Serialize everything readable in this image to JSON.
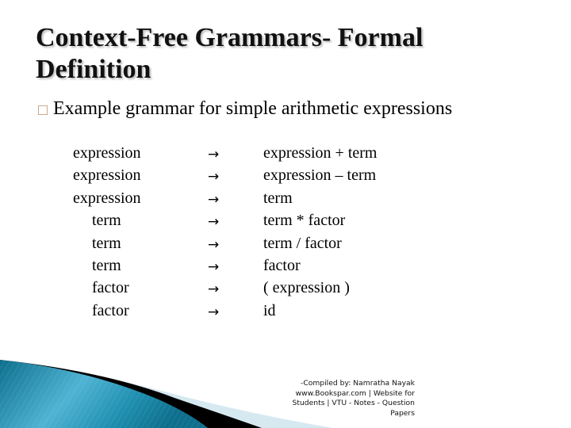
{
  "slide": {
    "title": "Context-Free Grammars- Formal Definition",
    "bullet": "Example grammar for simple arithmetic expressions",
    "arrow_symbol": "→",
    "rules": [
      {
        "lhs": "expression",
        "rhs": "expression + term",
        "indent": 0
      },
      {
        "lhs": "expression",
        "rhs": "expression – term",
        "indent": 0
      },
      {
        "lhs": "expression",
        "rhs": "term",
        "indent": 0
      },
      {
        "lhs": "term",
        "rhs": "term * factor",
        "indent": 1
      },
      {
        "lhs": "term",
        "rhs": "term / factor",
        "indent": 1
      },
      {
        "lhs": "term",
        "rhs": "factor",
        "indent": 1
      },
      {
        "lhs": "factor",
        "rhs": "( expression )",
        "indent": 1
      },
      {
        "lhs": "factor",
        "rhs": "id",
        "indent": 1
      }
    ],
    "footer_lines": [
      "-Compiled by: Namratha Nayak",
      "www.Bookspar.com | Website for",
      "Students | VTU - Notes - Question",
      "Papers"
    ]
  },
  "colors": {
    "bullet_border": "#c9a98e",
    "wave_teal_dark": "#0e6f8c",
    "wave_teal_light": "#4fb3d4",
    "wave_pale": "#d6e9f0"
  }
}
